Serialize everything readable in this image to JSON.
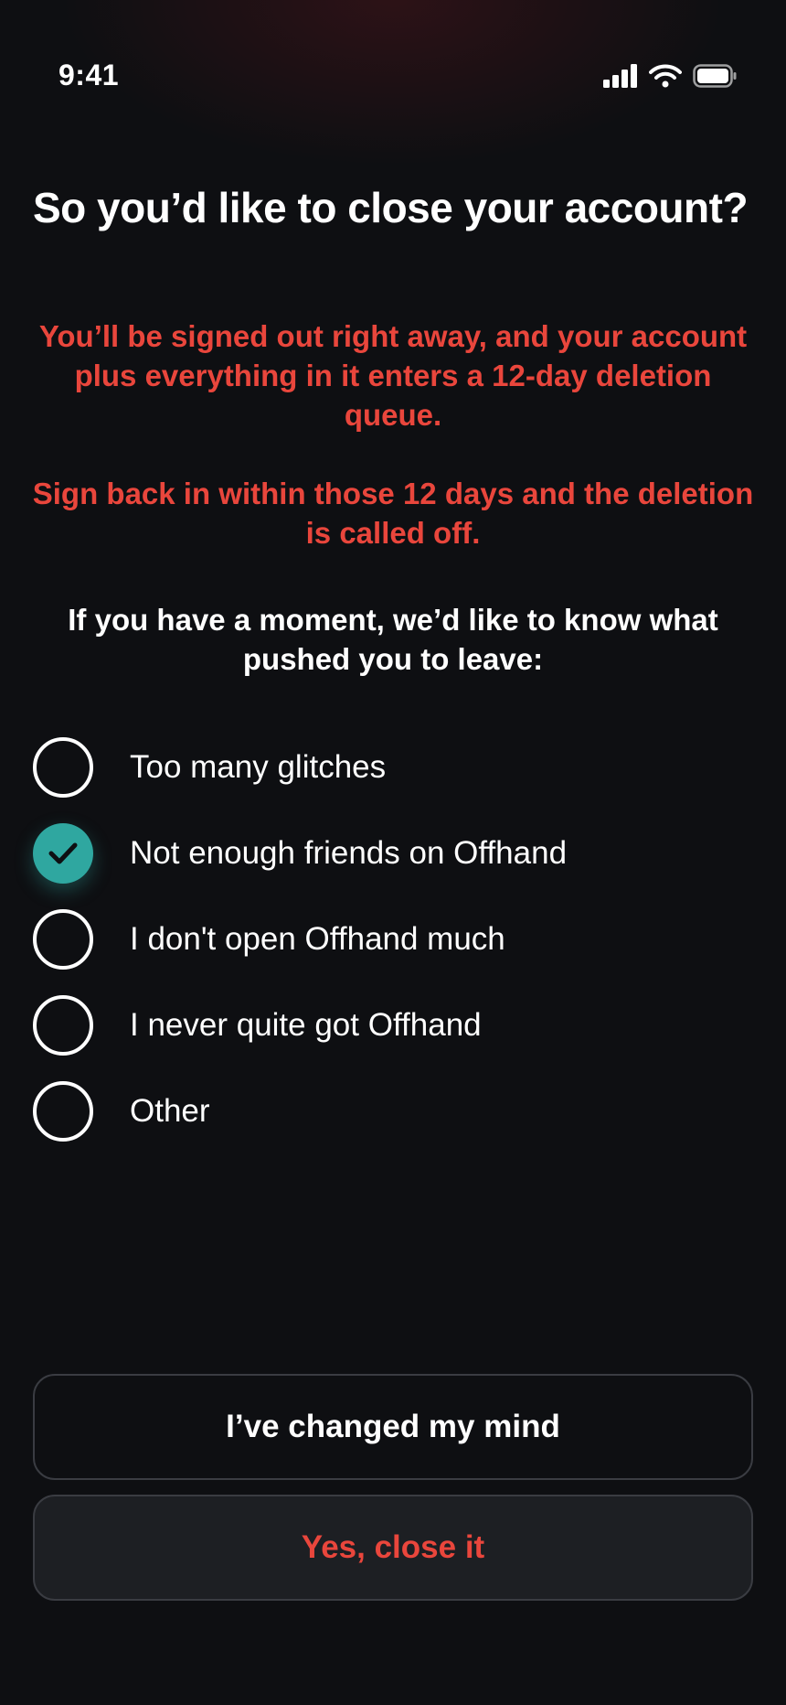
{
  "status_bar": {
    "time": "9:41",
    "icons": [
      "signal-icon",
      "wifi-icon",
      "battery-icon"
    ]
  },
  "title": "So you’d like to close your account?",
  "warning": {
    "paragraph_1": "You’ll be signed out right away, and your account plus everything in it enters a 12-day deletion queue.",
    "paragraph_2": "Sign back in within those 12 days and the deletion is called off.",
    "color": "#e9463c"
  },
  "question": "If you have a moment, we’d like to know what pushed you to leave:",
  "options": [
    {
      "label": "Too many glitches",
      "selected": false
    },
    {
      "label": "Not enough friends on Offhand",
      "selected": true
    },
    {
      "label": "I don't open Offhand much",
      "selected": false
    },
    {
      "label": "I never quite got Offhand",
      "selected": false
    },
    {
      "label": "Other",
      "selected": false
    }
  ],
  "accent_color": "#2fa7a0",
  "buttons": {
    "keep_label": "I’ve changed my mind",
    "close_label": "Yes, close it"
  }
}
